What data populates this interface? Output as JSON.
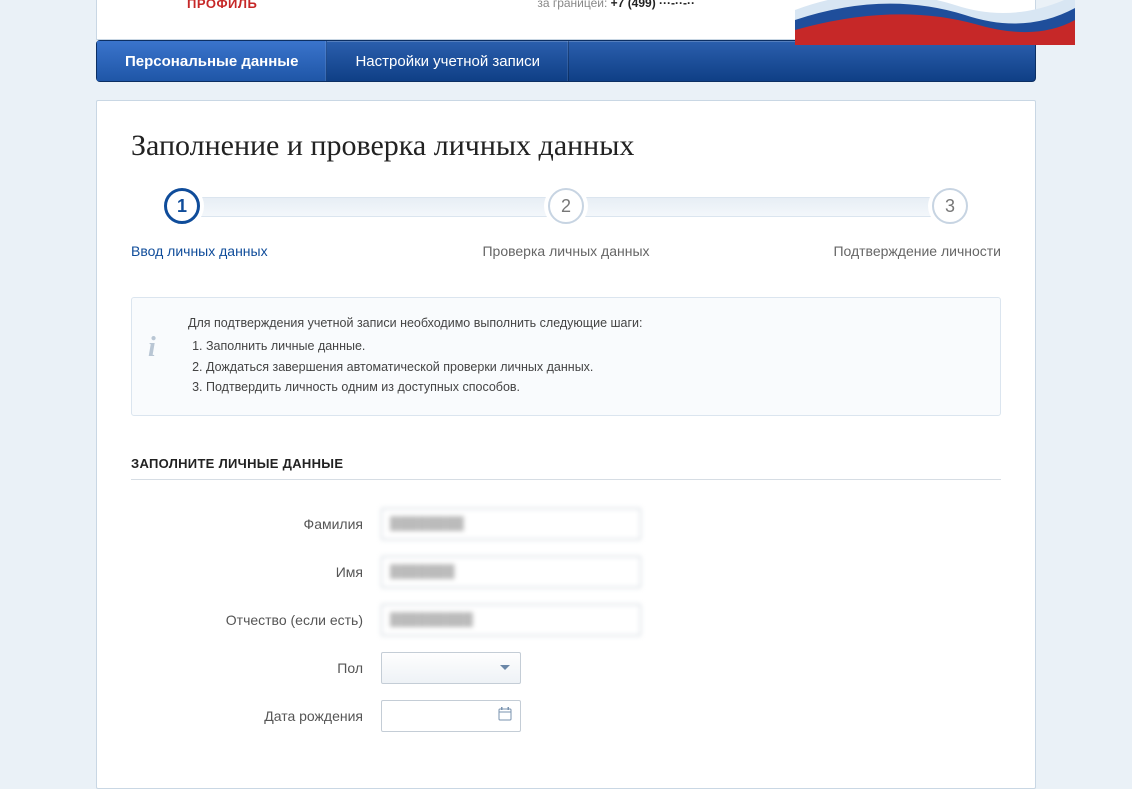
{
  "header": {
    "logo_text": "ПРОФИЛЬ",
    "phone_label": "за границей:",
    "phone_value": "+7 (499) ···-··-··"
  },
  "nav": {
    "items": [
      {
        "label": "Персональные данные",
        "active": true
      },
      {
        "label": "Настройки учетной записи",
        "active": false
      }
    ]
  },
  "page": {
    "title": "Заполнение и проверка личных данных"
  },
  "steps": {
    "s1": {
      "num": "1",
      "label": "Ввод личных данных"
    },
    "s2": {
      "num": "2",
      "label": "Проверка личных данных"
    },
    "s3": {
      "num": "3",
      "label": "Подтверждение личности"
    }
  },
  "info": {
    "intro": "Для подтверждения учетной записи необходимо выполнить следующие шаги:",
    "i1": "Заполнить личные данные.",
    "i2": "Дождаться завершения автоматической проверки личных данных.",
    "i3": "Подтвердить личность одним из доступных способов."
  },
  "form": {
    "section_title": "ЗАПОЛНИТЕ ЛИЧНЫЕ ДАННЫЕ",
    "lastname_label": "Фамилия",
    "lastname_value": "████████",
    "firstname_label": "Имя",
    "firstname_value": "███████",
    "patronymic_label": "Отчество (если есть)",
    "patronymic_value": "█████████",
    "gender_label": "Пол",
    "dob_label": "Дата рождения"
  }
}
